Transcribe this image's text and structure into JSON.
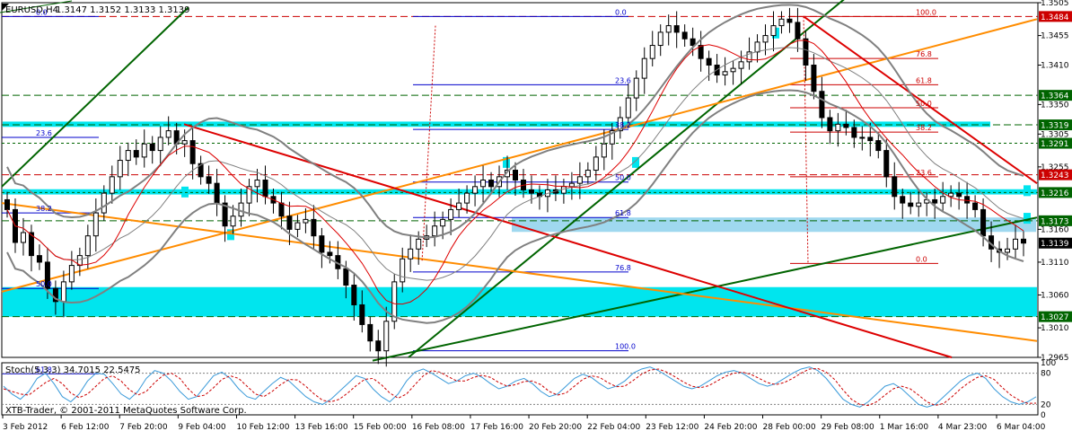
{
  "header": {
    "symbol": "EURUSD,H4",
    "ohlc": "1.3147 1.3152 1.3133 1.3139"
  },
  "stoch_header": "Stoch(5,3,3) 34.7015 22.5475",
  "copyright": "XTB-Trader, © 2001-2011 MetaQuotes Software Corp.",
  "chart_data": {
    "type": "candlestick",
    "timeframe": "H4",
    "price_axis": {
      "ylim": [
        1.2965,
        1.3505
      ],
      "ticks": [
        "1.3505",
        "1.3455",
        "1.3410",
        "1.3350",
        "1.3305",
        "1.3255",
        "1.3160",
        "1.3110",
        "1.3060",
        "1.3010",
        "1.2965"
      ]
    },
    "x_labels": [
      "3 Feb 2012",
      "6 Feb 12:00",
      "7 Feb 20:00",
      "9 Feb 04:00",
      "10 Feb 12:00",
      "13 Feb 16:00",
      "15 Feb 00:00",
      "16 Feb 08:00",
      "17 Feb 16:00",
      "20 Feb 20:00",
      "22 Feb 04:00",
      "23 Feb 12:00",
      "24 Feb 20:00",
      "28 Feb 00:00",
      "29 Feb 08:00",
      "1 Mar 16:00",
      "4 Mar 23:00",
      "6 Mar 04:00"
    ],
    "closes": [
      1.319,
      1.314,
      1.3155,
      1.312,
      1.311,
      1.307,
      1.305,
      1.308,
      1.3105,
      1.312,
      1.315,
      1.3185,
      1.3215,
      1.324,
      1.3265,
      1.328,
      1.327,
      1.329,
      1.328,
      1.33,
      1.331,
      1.329,
      1.3295,
      1.326,
      1.324,
      1.323,
      1.32,
      1.3165,
      1.318,
      1.32,
      1.3225,
      1.3235,
      1.321,
      1.32,
      1.318,
      1.316,
      1.317,
      1.3175,
      1.315,
      1.3125,
      1.312,
      1.31,
      1.3075,
      1.3045,
      1.3015,
      1.299,
      1.2975,
      1.302,
      1.308,
      1.3115,
      1.313,
      1.3145,
      1.315,
      1.3165,
      1.3175,
      1.319,
      1.32,
      1.3215,
      1.3225,
      1.3235,
      1.3225,
      1.324,
      1.325,
      1.3235,
      1.322,
      1.3215,
      1.321,
      1.322,
      1.3215,
      1.3225,
      1.323,
      1.324,
      1.325,
      1.327,
      1.329,
      1.331,
      1.333,
      1.336,
      1.339,
      1.342,
      1.344,
      1.346,
      1.347,
      1.346,
      1.345,
      1.344,
      1.342,
      1.341,
      1.3395,
      1.34,
      1.3405,
      1.3415,
      1.343,
      1.3445,
      1.3455,
      1.347,
      1.348,
      1.3475,
      1.345,
      1.341,
      1.337,
      1.333,
      1.331,
      1.332,
      1.3315,
      1.33,
      1.33,
      1.3295,
      1.328,
      1.324,
      1.321,
      1.32,
      1.3195,
      1.32,
      1.3205,
      1.32,
      1.321,
      1.3215,
      1.321,
      1.32,
      1.319,
      1.315,
      1.313,
      1.3125,
      1.313,
      1.3145,
      1.3139
    ],
    "bollinger": {
      "upper_offset": 0.0065,
      "lower_offset": 0.0065
    },
    "moving_average": "red",
    "fibonacci_left": [
      "0.0",
      "23.6",
      "38.2",
      "50.0",
      "61.8",
      "76.8",
      "100.0"
    ],
    "fibonacci_right": [
      "100.0",
      "76.8",
      "61.8",
      "50.0",
      "38.2",
      "23.6",
      "0.0"
    ],
    "fibonacci_side": [
      "23.6",
      "38.2",
      "50.0",
      "61.8"
    ],
    "level_labels": [
      {
        "value": "1.3484",
        "color": "#cc0000"
      },
      {
        "value": "1.3364",
        "color": "#006400"
      },
      {
        "value": "1.3319",
        "color": "#006400"
      },
      {
        "value": "1.3291",
        "color": "#006400"
      },
      {
        "value": "1.3243",
        "color": "#cc0000"
      },
      {
        "value": "1.3216",
        "color": "#006400"
      },
      {
        "value": "1.3173",
        "color": "#006400"
      },
      {
        "value": "1.3139",
        "color": "#000000"
      },
      {
        "value": "1.3027",
        "color": "#006400"
      }
    ],
    "stochastic": {
      "ylim": [
        0,
        100
      ],
      "levels": [
        "80",
        "20"
      ],
      "ticks": [
        "100",
        "80",
        "20",
        "0"
      ],
      "k": [
        55,
        40,
        30,
        45,
        70,
        80,
        60,
        35,
        25,
        40,
        65,
        80,
        78,
        60,
        40,
        30,
        45,
        70,
        85,
        80,
        65,
        45,
        30,
        35,
        55,
        75,
        82,
        70,
        50,
        35,
        30,
        45,
        60,
        72,
        65,
        50,
        35,
        25,
        20,
        30,
        45,
        60,
        75,
        70,
        50,
        35,
        25,
        40,
        65,
        82,
        88,
        80,
        70,
        60,
        65,
        75,
        80,
        72,
        60,
        50,
        55,
        65,
        70,
        60,
        45,
        35,
        40,
        55,
        70,
        78,
        72,
        60,
        50,
        55,
        65,
        80,
        88,
        92,
        85,
        75,
        65,
        55,
        50,
        55,
        65,
        75,
        82,
        85,
        80,
        70,
        60,
        55,
        60,
        70,
        80,
        88,
        92,
        85,
        70,
        50,
        30,
        20,
        15,
        25,
        40,
        55,
        60,
        50,
        35,
        20,
        15,
        20,
        35,
        50,
        65,
        75,
        80,
        70,
        50,
        35,
        25,
        20,
        25,
        34.7
      ],
      "d": [
        50,
        45,
        40,
        38,
        50,
        62,
        70,
        60,
        42,
        33,
        40,
        55,
        70,
        75,
        65,
        48,
        38,
        45,
        62,
        76,
        80,
        70,
        50,
        35,
        38,
        52,
        68,
        75,
        70,
        55,
        40,
        35,
        45,
        58,
        68,
        67,
        55,
        40,
        28,
        25,
        30,
        42,
        56,
        68,
        70,
        58,
        42,
        32,
        40,
        58,
        75,
        85,
        82,
        73,
        65,
        65,
        72,
        76,
        72,
        62,
        55,
        58,
        64,
        65,
        58,
        45,
        38,
        42,
        55,
        68,
        75,
        72,
        62,
        54,
        55,
        66,
        78,
        86,
        88,
        82,
        73,
        63,
        55,
        52,
        56,
        65,
        74,
        80,
        82,
        78,
        70,
        62,
        58,
        62,
        70,
        80,
        88,
        89,
        82,
        68,
        48,
        30,
        20,
        18,
        25,
        38,
        50,
        55,
        50,
        38,
        25,
        18,
        22,
        35,
        50,
        62,
        72,
        75,
        68,
        52,
        38,
        28,
        22,
        22.5
      ]
    }
  }
}
